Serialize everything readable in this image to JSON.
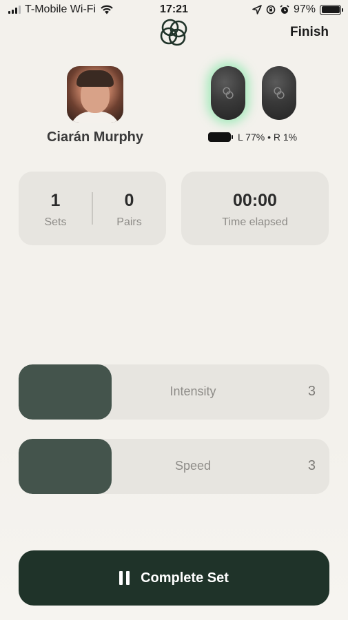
{
  "status_bar": {
    "carrier": "T-Mobile Wi-Fi",
    "time": "17:21",
    "battery_percent": "97%"
  },
  "header": {
    "finish_label": "Finish"
  },
  "profile": {
    "name": "Ciarán Murphy"
  },
  "earbuds": {
    "status_text": "L 77% • R 1%",
    "left_active": true
  },
  "stats": {
    "sets_value": "1",
    "sets_label": "Sets",
    "pairs_value": "0",
    "pairs_label": "Pairs",
    "time_value": "00:00",
    "time_label": "Time elapsed"
  },
  "controls": {
    "intensity_label": "Intensity",
    "intensity_value": "3",
    "speed_label": "Speed",
    "speed_value": "3"
  },
  "actions": {
    "complete_label": "Complete Set"
  },
  "colors": {
    "accent": "#1f3329",
    "slider_fill": "#44544c",
    "card_bg": "#e7e5e0",
    "glow": "#78e6a0"
  },
  "icons": [
    "signal-icon",
    "wifi-icon",
    "location-icon",
    "alarm-lock-icon",
    "alarm-icon",
    "battery-icon",
    "logo-icon",
    "pause-icon"
  ]
}
